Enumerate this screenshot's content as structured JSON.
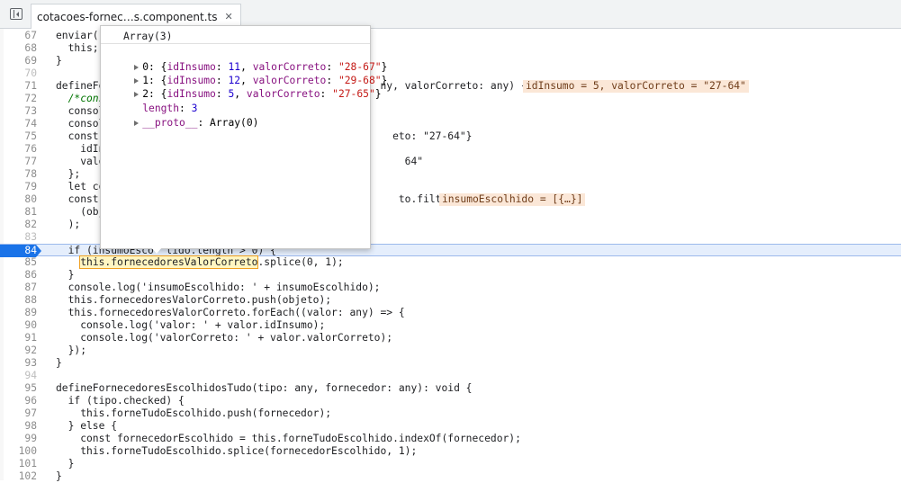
{
  "tab": {
    "filename": "cotacoes-fornec…s.component.ts",
    "close": "✕"
  },
  "colors": {
    "accent": "#1a73e8",
    "inline_value_bg": "#fbe7d7",
    "exec_line_bg": "#e5eefc"
  },
  "icons": {
    "sidebar_toggle": "navigator-toggle-icon",
    "close": "close-icon"
  },
  "popover": {
    "title": "Array(3)",
    "items": [
      {
        "index": "0:",
        "open": "{",
        "k1": "idInsumo",
        "v1": "11",
        "k2": "valorCorreto",
        "v2": "\"28-67\"",
        "close": "}"
      },
      {
        "index": "1:",
        "open": "{",
        "k1": "idInsumo",
        "v1": "12",
        "k2": "valorCorreto",
        "v2": "\"29-68\"",
        "close": "}"
      },
      {
        "index": "2:",
        "open": "{",
        "k1": "idInsumo",
        "v1": "5",
        "k2": "valorCorreto",
        "v2": "\"27-65\"",
        "close": "}"
      }
    ],
    "length_key": "length",
    "length_value": "3",
    "proto_key": "__proto__",
    "proto_value": "Array(0)"
  },
  "lines": [
    {
      "n": "67",
      "code": "enviar()"
    },
    {
      "n": "68",
      "code": "  this;"
    },
    {
      "n": "69",
      "code": "}"
    },
    {
      "n": "70",
      "code": ""
    },
    {
      "n": "71",
      "code": "defineFo                                             ny, valorCorreto: any) {"
    },
    {
      "n": "72",
      "code": "  /*cons"
    },
    {
      "n": "73",
      "code": "  consol"
    },
    {
      "n": "74",
      "code": "  consol"
    },
    {
      "n": "75",
      "code": "  const                                                eto: \"27-64\"}"
    },
    {
      "n": "76",
      "code": "    idIn"
    },
    {
      "n": "77",
      "code": "    valo                                                 64\""
    },
    {
      "n": "78",
      "code": "  };"
    },
    {
      "n": "79",
      "code": "  let co"
    },
    {
      "n": "80",
      "code": "  const                                                 to.filter("
    },
    {
      "n": "81",
      "code": "    (obj"
    },
    {
      "n": "82",
      "code": "  );"
    },
    {
      "n": "83",
      "code": ""
    },
    {
      "n": "84",
      "code": "  if (insumoEsco  lido.length > 0) {"
    },
    {
      "n": "85",
      "code": "    this.fornecedoresValorCorreto.splice(0, 1);"
    },
    {
      "n": "86",
      "code": "  }"
    },
    {
      "n": "87",
      "code": "  console.log('insumoEscolhido: ' + insumoEscolhido);"
    },
    {
      "n": "88",
      "code": "  this.fornecedoresValorCorreto.push(objeto);"
    },
    {
      "n": "89",
      "code": "  this.fornecedoresValorCorreto.forEach((valor: any) => {"
    },
    {
      "n": "90",
      "code": "    console.log('valor: ' + valor.idInsumo);"
    },
    {
      "n": "91",
      "code": "    console.log('valorCorreto: ' + valor.valorCorreto);"
    },
    {
      "n": "92",
      "code": "  });"
    },
    {
      "n": "93",
      "code": "}"
    },
    {
      "n": "94",
      "code": ""
    },
    {
      "n": "95",
      "code": "defineFornecedoresEscolhidosTudo(tipo: any, fornecedor: any): void {"
    },
    {
      "n": "96",
      "code": "  if (tipo.checked) {"
    },
    {
      "n": "97",
      "code": "    this.forneTudoEscolhido.push(fornecedor);"
    },
    {
      "n": "98",
      "code": "  } else {"
    },
    {
      "n": "99",
      "code": "    const fornecedorEscolhido = this.forneTudoEscolhido.indexOf(fornecedor);"
    },
    {
      "n": "100",
      "code": "    this.forneTudoEscolhido.splice(fornecedorEscolhido, 1);"
    },
    {
      "n": "101",
      "code": "  }"
    },
    {
      "n": "102",
      "code": "}"
    }
  ],
  "inline_values": {
    "line71": "idInsumo = 5, valorCorreto = \"27-64\"",
    "line80": "insumoEscolhido = [{…}]"
  },
  "execution_line": "84"
}
